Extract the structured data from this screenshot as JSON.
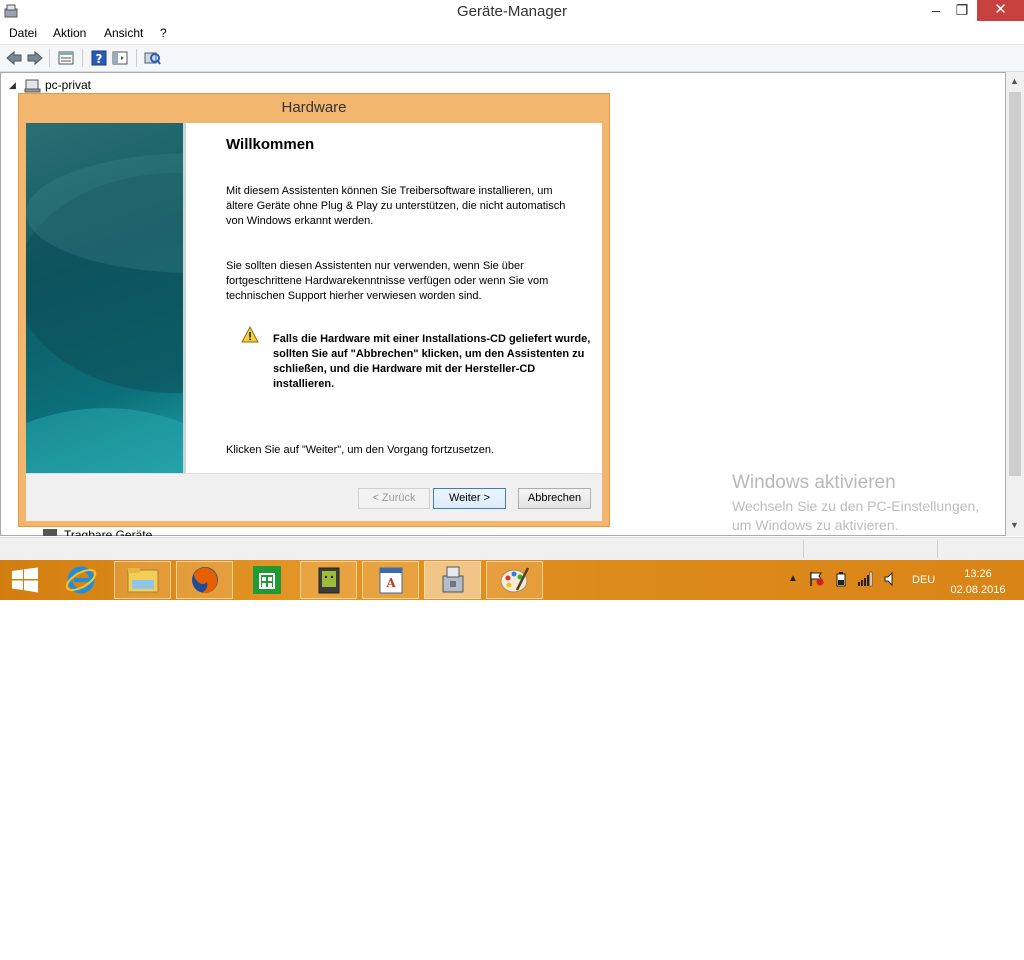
{
  "window": {
    "title": "Geräte-Manager",
    "minimize_glyph": "–",
    "maximize_glyph": "❐",
    "close_glyph": "✕"
  },
  "menu": [
    "Datei",
    "Aktion",
    "Ansicht",
    "?"
  ],
  "tree": {
    "root_label": "pc-privat",
    "bottom_label": "Tragbare Geräte"
  },
  "dialog": {
    "title": "Hardware",
    "heading": "Willkommen",
    "para1": "Mit diesem Assistenten können Sie Treibersoftware installieren, um ältere Geräte ohne Plug & Play zu unterstützen, die nicht automatisch von Windows erkannt werden.",
    "para2": "Sie sollten diesen Assistenten nur verwenden, wenn Sie über fortgeschrittene Hardwarekenntnisse verfügen oder wenn Sie vom technischen Support hierher verwiesen worden sind.",
    "warning": "Falls die Hardware mit einer Installations-CD geliefert wurde, sollten Sie auf \"Abbrechen\" klicken, um den Assistenten zu schließen, und die Hardware mit der Hersteller-CD installieren.",
    "para3": "Klicken Sie auf \"Weiter\", um den Vorgang fortzusetzen.",
    "back_label": "< Zurück",
    "next_label": "Weiter >",
    "cancel_label": "Abbrechen"
  },
  "watermark": {
    "title": "Windows aktivieren",
    "line1": "Wechseln Sie zu den PC-Einstellungen,",
    "line2": "um Windows zu aktivieren."
  },
  "taskbar": {
    "apps": [
      "start-icon",
      "internet-explorer-icon",
      "file-explorer-icon",
      "firefox-icon",
      "store-icon",
      "android-icon",
      "wordpad-icon",
      "device-manager-icon",
      "paint-icon"
    ],
    "language": "DEU",
    "time": "13:26",
    "date": "02.08.2016"
  },
  "colors": {
    "taskbar": "#dd8a1c",
    "dialog_frame": "#f2b66e",
    "close_button": "#c7413e",
    "banner": "#0f5a62"
  }
}
